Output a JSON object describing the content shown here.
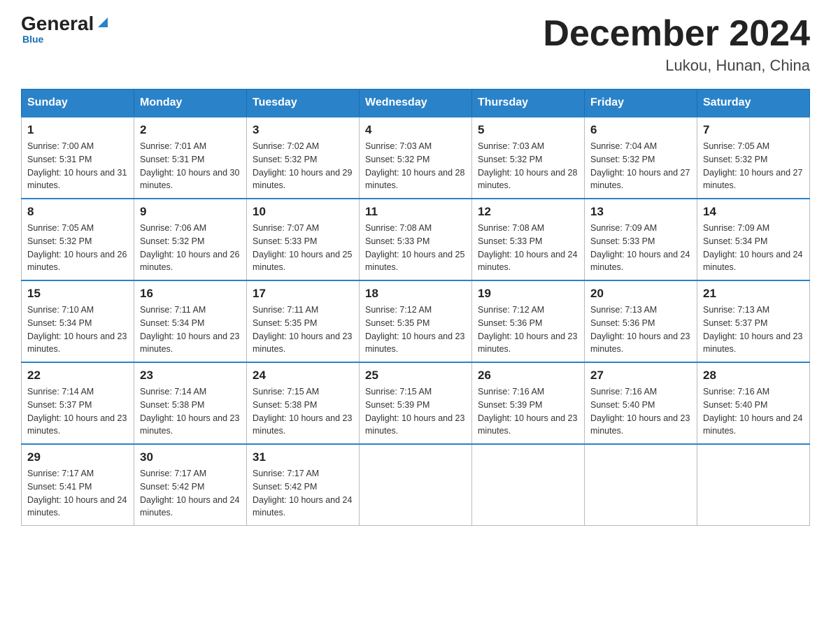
{
  "logo": {
    "general": "General",
    "arrow": "▶",
    "blue": "Blue"
  },
  "title": "December 2024",
  "subtitle": "Lukou, Hunan, China",
  "weekdays": [
    "Sunday",
    "Monday",
    "Tuesday",
    "Wednesday",
    "Thursday",
    "Friday",
    "Saturday"
  ],
  "weeks": [
    [
      {
        "day": "1",
        "sunrise": "7:00 AM",
        "sunset": "5:31 PM",
        "daylight": "10 hours and 31 minutes."
      },
      {
        "day": "2",
        "sunrise": "7:01 AM",
        "sunset": "5:31 PM",
        "daylight": "10 hours and 30 minutes."
      },
      {
        "day": "3",
        "sunrise": "7:02 AM",
        "sunset": "5:32 PM",
        "daylight": "10 hours and 29 minutes."
      },
      {
        "day": "4",
        "sunrise": "7:03 AM",
        "sunset": "5:32 PM",
        "daylight": "10 hours and 28 minutes."
      },
      {
        "day": "5",
        "sunrise": "7:03 AM",
        "sunset": "5:32 PM",
        "daylight": "10 hours and 28 minutes."
      },
      {
        "day": "6",
        "sunrise": "7:04 AM",
        "sunset": "5:32 PM",
        "daylight": "10 hours and 27 minutes."
      },
      {
        "day": "7",
        "sunrise": "7:05 AM",
        "sunset": "5:32 PM",
        "daylight": "10 hours and 27 minutes."
      }
    ],
    [
      {
        "day": "8",
        "sunrise": "7:05 AM",
        "sunset": "5:32 PM",
        "daylight": "10 hours and 26 minutes."
      },
      {
        "day": "9",
        "sunrise": "7:06 AM",
        "sunset": "5:32 PM",
        "daylight": "10 hours and 26 minutes."
      },
      {
        "day": "10",
        "sunrise": "7:07 AM",
        "sunset": "5:33 PM",
        "daylight": "10 hours and 25 minutes."
      },
      {
        "day": "11",
        "sunrise": "7:08 AM",
        "sunset": "5:33 PM",
        "daylight": "10 hours and 25 minutes."
      },
      {
        "day": "12",
        "sunrise": "7:08 AM",
        "sunset": "5:33 PM",
        "daylight": "10 hours and 24 minutes."
      },
      {
        "day": "13",
        "sunrise": "7:09 AM",
        "sunset": "5:33 PM",
        "daylight": "10 hours and 24 minutes."
      },
      {
        "day": "14",
        "sunrise": "7:09 AM",
        "sunset": "5:34 PM",
        "daylight": "10 hours and 24 minutes."
      }
    ],
    [
      {
        "day": "15",
        "sunrise": "7:10 AM",
        "sunset": "5:34 PM",
        "daylight": "10 hours and 23 minutes."
      },
      {
        "day": "16",
        "sunrise": "7:11 AM",
        "sunset": "5:34 PM",
        "daylight": "10 hours and 23 minutes."
      },
      {
        "day": "17",
        "sunrise": "7:11 AM",
        "sunset": "5:35 PM",
        "daylight": "10 hours and 23 minutes."
      },
      {
        "day": "18",
        "sunrise": "7:12 AM",
        "sunset": "5:35 PM",
        "daylight": "10 hours and 23 minutes."
      },
      {
        "day": "19",
        "sunrise": "7:12 AM",
        "sunset": "5:36 PM",
        "daylight": "10 hours and 23 minutes."
      },
      {
        "day": "20",
        "sunrise": "7:13 AM",
        "sunset": "5:36 PM",
        "daylight": "10 hours and 23 minutes."
      },
      {
        "day": "21",
        "sunrise": "7:13 AM",
        "sunset": "5:37 PM",
        "daylight": "10 hours and 23 minutes."
      }
    ],
    [
      {
        "day": "22",
        "sunrise": "7:14 AM",
        "sunset": "5:37 PM",
        "daylight": "10 hours and 23 minutes."
      },
      {
        "day": "23",
        "sunrise": "7:14 AM",
        "sunset": "5:38 PM",
        "daylight": "10 hours and 23 minutes."
      },
      {
        "day": "24",
        "sunrise": "7:15 AM",
        "sunset": "5:38 PM",
        "daylight": "10 hours and 23 minutes."
      },
      {
        "day": "25",
        "sunrise": "7:15 AM",
        "sunset": "5:39 PM",
        "daylight": "10 hours and 23 minutes."
      },
      {
        "day": "26",
        "sunrise": "7:16 AM",
        "sunset": "5:39 PM",
        "daylight": "10 hours and 23 minutes."
      },
      {
        "day": "27",
        "sunrise": "7:16 AM",
        "sunset": "5:40 PM",
        "daylight": "10 hours and 23 minutes."
      },
      {
        "day": "28",
        "sunrise": "7:16 AM",
        "sunset": "5:40 PM",
        "daylight": "10 hours and 24 minutes."
      }
    ],
    [
      {
        "day": "29",
        "sunrise": "7:17 AM",
        "sunset": "5:41 PM",
        "daylight": "10 hours and 24 minutes."
      },
      {
        "day": "30",
        "sunrise": "7:17 AM",
        "sunset": "5:42 PM",
        "daylight": "10 hours and 24 minutes."
      },
      {
        "day": "31",
        "sunrise": "7:17 AM",
        "sunset": "5:42 PM",
        "daylight": "10 hours and 24 minutes."
      },
      null,
      null,
      null,
      null
    ]
  ],
  "labels": {
    "sunrise": "Sunrise:",
    "sunset": "Sunset:",
    "daylight": "Daylight:"
  }
}
